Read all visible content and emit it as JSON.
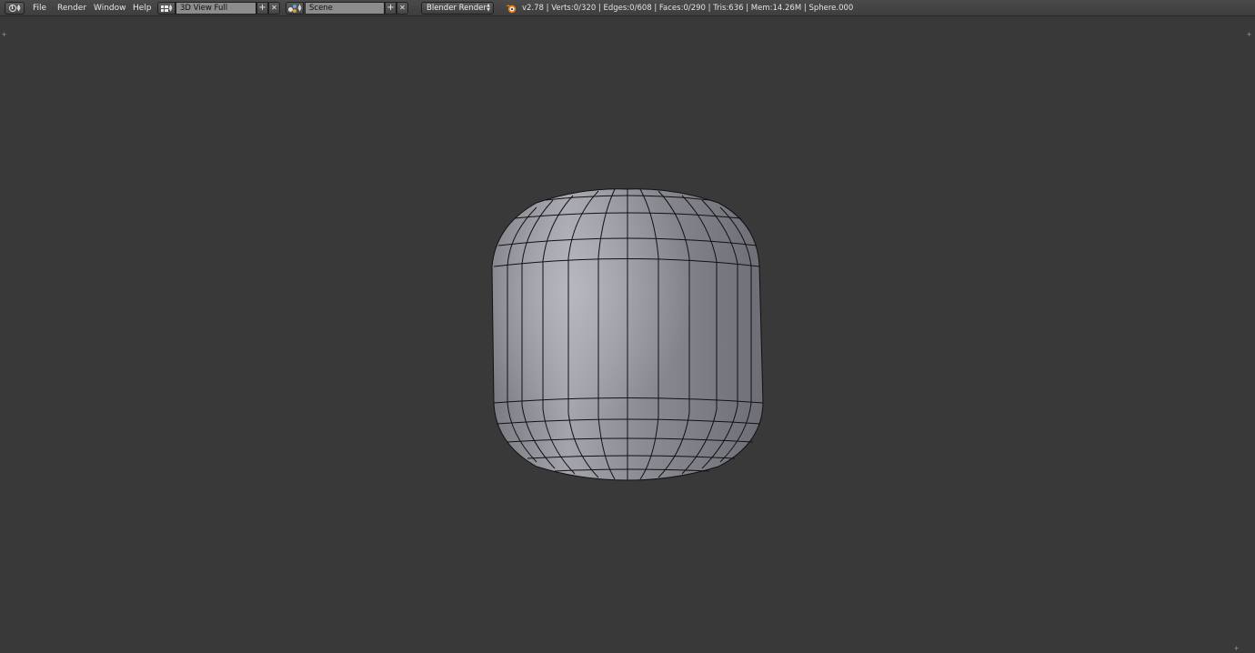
{
  "menus": [
    "File",
    "Render",
    "Window",
    "Help"
  ],
  "screen_layout": {
    "name": "3D View Full",
    "add_label": "+",
    "remove_label": "✕"
  },
  "scene": {
    "name": "Scene",
    "add_label": "+",
    "remove_label": "✕"
  },
  "render_engine": "Blender Render",
  "stats": "v2.78 | Verts:0/320 | Edges:0/608 | Faces:0/290 | Tris:636 | Mem:14.26M | Sphere.000",
  "icons": {
    "editor_type": "info-icon",
    "layout": "screen-layout-icon",
    "scene": "scene-icon",
    "logo": "blender-logo-icon"
  },
  "colors": {
    "header": "#444444",
    "viewport_bg": "#393939",
    "mesh_face": "#8e8e96",
    "wire": "#111111"
  }
}
